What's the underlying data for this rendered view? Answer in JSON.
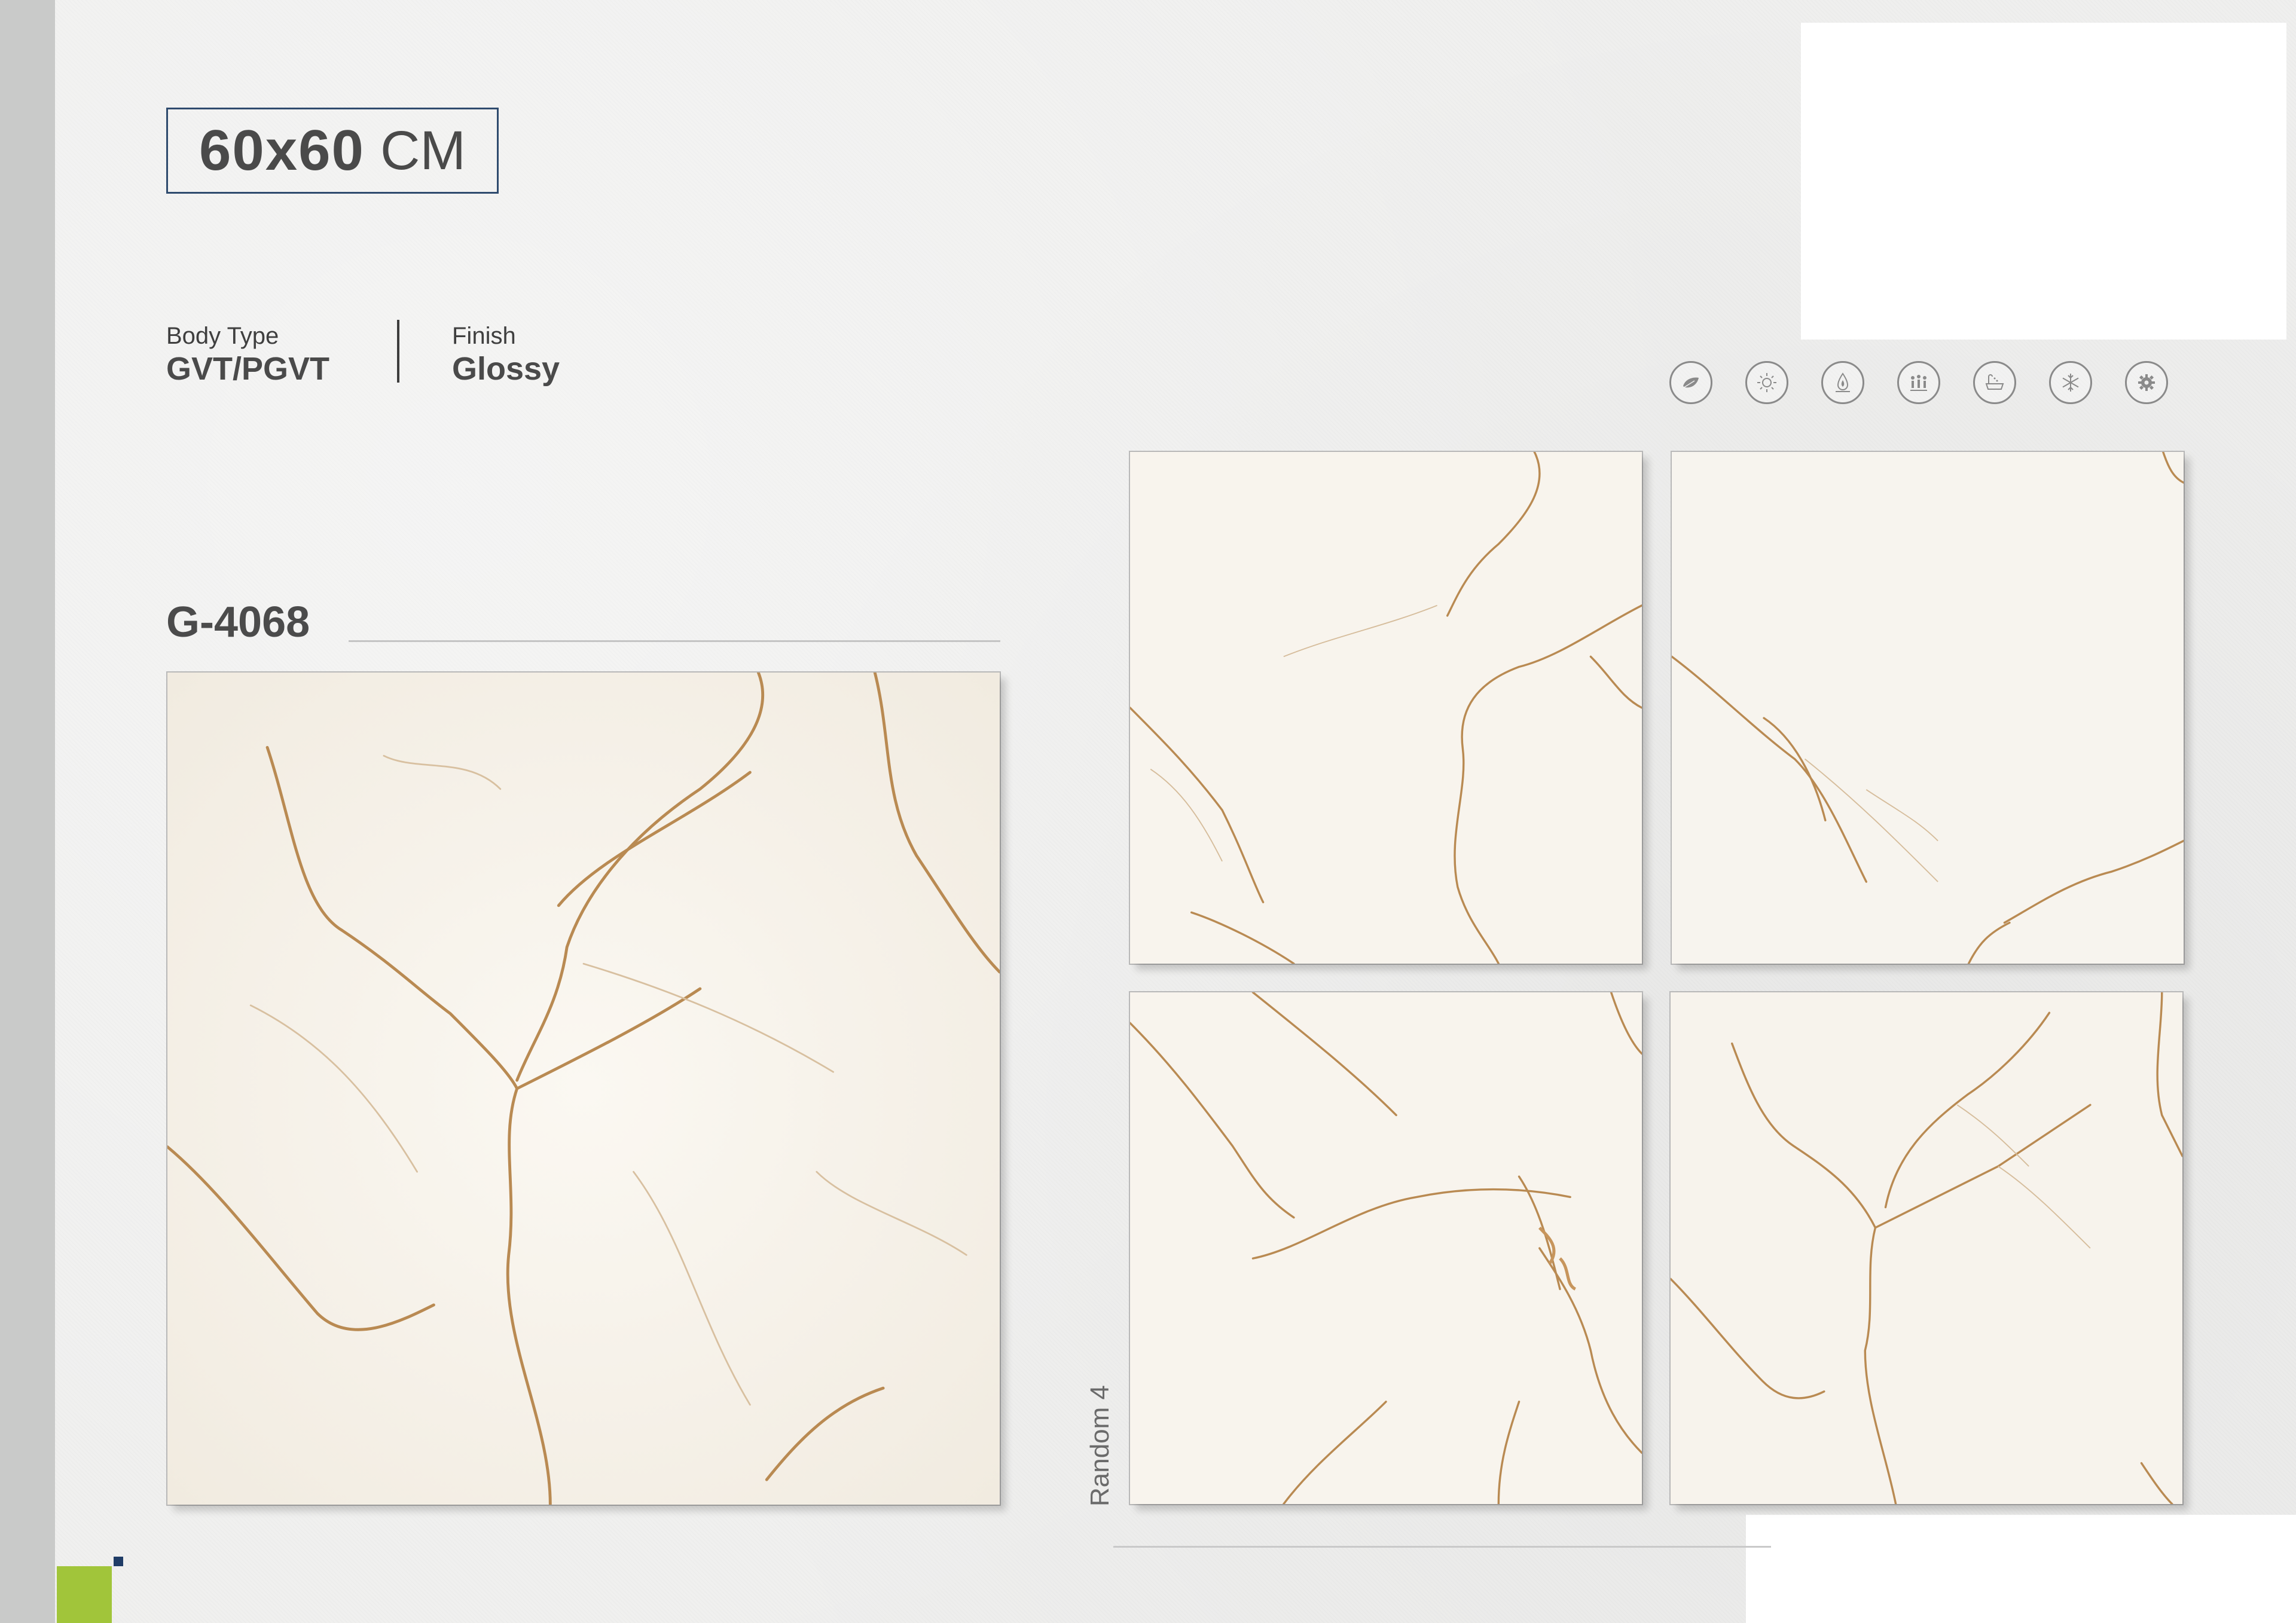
{
  "size": {
    "dimension": "60x60",
    "unit": "CM"
  },
  "specs": {
    "body_type": {
      "label": "Body Type",
      "value": "GVT/PGVT"
    },
    "finish": {
      "label": "Finish",
      "value": "Glossy"
    }
  },
  "product": {
    "code": "G-4068"
  },
  "layout_label": "Random 4",
  "feature_icons": [
    "leaf-icon",
    "sun-icon",
    "flame-drop-icon",
    "people-icon",
    "bathtub-icon",
    "snowflake-icon",
    "gear-icon"
  ],
  "colors": {
    "accent_green": "#a1c53a",
    "accent_navy": "#1f3c66",
    "marble_base": "#f7f3ec",
    "marble_vein": "#b98a52"
  }
}
